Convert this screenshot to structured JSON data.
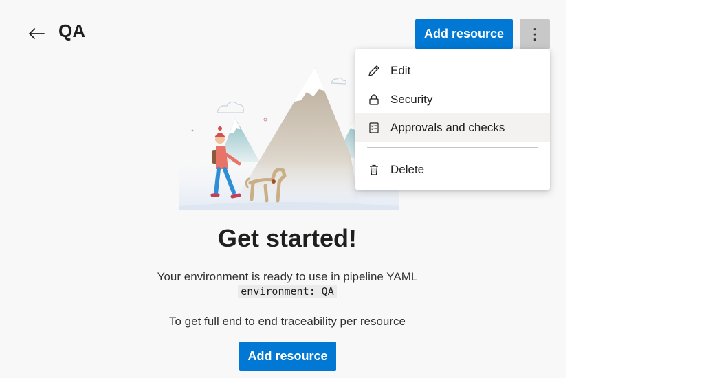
{
  "header": {
    "title": "QA",
    "add_resource_label": "Add resource",
    "more_label": "⋮"
  },
  "main": {
    "headline": "Get started!",
    "description": "Your environment is ready to use in pipeline YAML",
    "code": "environment: QA",
    "traceability": "To get full end to end traceability per resource",
    "add_resource_label": "Add resource"
  },
  "menu": {
    "items": [
      {
        "label": "Edit",
        "icon": "pencil-icon"
      },
      {
        "label": "Security",
        "icon": "lock-icon"
      },
      {
        "label": "Approvals and checks",
        "icon": "checklist-icon"
      },
      {
        "label": "Delete",
        "icon": "trash-icon"
      }
    ]
  },
  "colors": {
    "primary": "#0078d4",
    "background": "#f8f8f8",
    "menu_hover": "#f3f2f1",
    "more_button": "#c8c8c8"
  }
}
